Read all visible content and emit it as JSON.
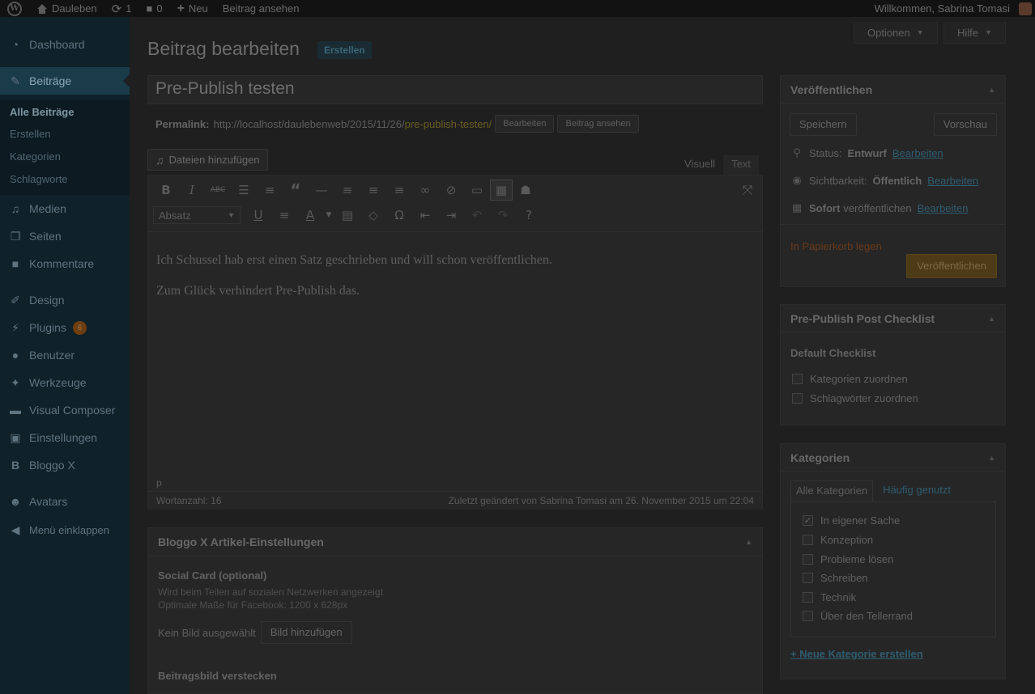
{
  "adminbar": {
    "site_name": "Dauleben",
    "updates_count": "1",
    "comments_count": "0",
    "new_label": "Neu",
    "view_post": "Beitrag ansehen",
    "greeting": "Willkommen, Sabrina Tomasi"
  },
  "sidebar": {
    "dashboard": "Dashboard",
    "posts": "Beiträge",
    "submenu": [
      "Alle Beiträge",
      "Erstellen",
      "Kategorien",
      "Schlagworte"
    ],
    "media": "Medien",
    "pages": "Seiten",
    "comments": "Kommentare",
    "design": "Design",
    "plugins": "Plugins",
    "plugins_badge": "6",
    "users": "Benutzer",
    "tools": "Werkzeuge",
    "visual_composer": "Visual Composer",
    "settings": "Einstellungen",
    "bloggo": "Bloggo X",
    "avatars": "Avatars",
    "collapse": "Menü einklappen"
  },
  "header": {
    "title": "Beitrag bearbeiten",
    "add_new": "Erstellen",
    "options": "Optionen",
    "help": "Hilfe"
  },
  "post": {
    "title": "Pre-Publish testen",
    "permalink_label": "Permalink:",
    "permalink_base": "http://localhost/daulebenweb/2015/11/26/",
    "permalink_slug": "pre-publish-testen/",
    "edit_btn": "Bearbeiten",
    "view_btn": "Beitrag ansehen"
  },
  "editor": {
    "add_media": "Dateien hinzufügen",
    "tab_visual": "Visuell",
    "tab_text": "Text",
    "format_select": "Absatz",
    "paragraphs": [
      "Ich Schussel hab erst einen Satz geschrieben und will schon veröffentlichen.",
      "Zum Glück verhindert Pre-Publish das."
    ],
    "path": "p",
    "word_count": "Wortanzahl: 16",
    "last_edited": "Zuletzt geändert von Sabrina Tomasi am 26. November 2015 um 22:04"
  },
  "bloggo_box": {
    "title": "Bloggo X Artikel-Einstellungen",
    "social_label": "Social Card (optional)",
    "social_desc1": "Wird beim Teilen auf sozialen Netzwerken angezeigt",
    "social_desc2": "Optimale Maße für Facebook: 1200 x 628px",
    "no_image": "Kein Bild ausgewählt",
    "add_image": "Bild hinzufügen",
    "hide_featured": "Beitragsbild verstecken"
  },
  "publish_box": {
    "title": "Veröffentlichen",
    "save_draft": "Speichern",
    "preview": "Vorschau",
    "status_label": "Status:",
    "status_value": "Entwurf",
    "visibility_label": "Sichtbarkeit:",
    "visibility_value": "Öffentlich",
    "schedule_value": "Sofort",
    "schedule_label": "veröffentlichen",
    "edit_link": "Bearbeiten",
    "trash": "In Papierkorb legen",
    "publish": "Veröffentlichen"
  },
  "checklist_box": {
    "title": "Pre-Publish Post Checklist",
    "subtitle": "Default Checklist",
    "items": [
      "Kategorien zuordnen",
      "Schlagwörter zuordnen"
    ]
  },
  "categories_box": {
    "title": "Kategorien",
    "tab_all": "Alle Kategorien",
    "tab_popular": "Häufig genutzt",
    "items": [
      {
        "label": "In eigener Sache",
        "checked": true
      },
      {
        "label": "Konzeption",
        "checked": false
      },
      {
        "label": "Probleme lösen",
        "checked": false
      },
      {
        "label": "Schreiben",
        "checked": false
      },
      {
        "label": "Technik",
        "checked": false
      },
      {
        "label": "Über den Tellerrand",
        "checked": false
      }
    ],
    "add_new": "+ Neue Kategorie erstellen"
  }
}
